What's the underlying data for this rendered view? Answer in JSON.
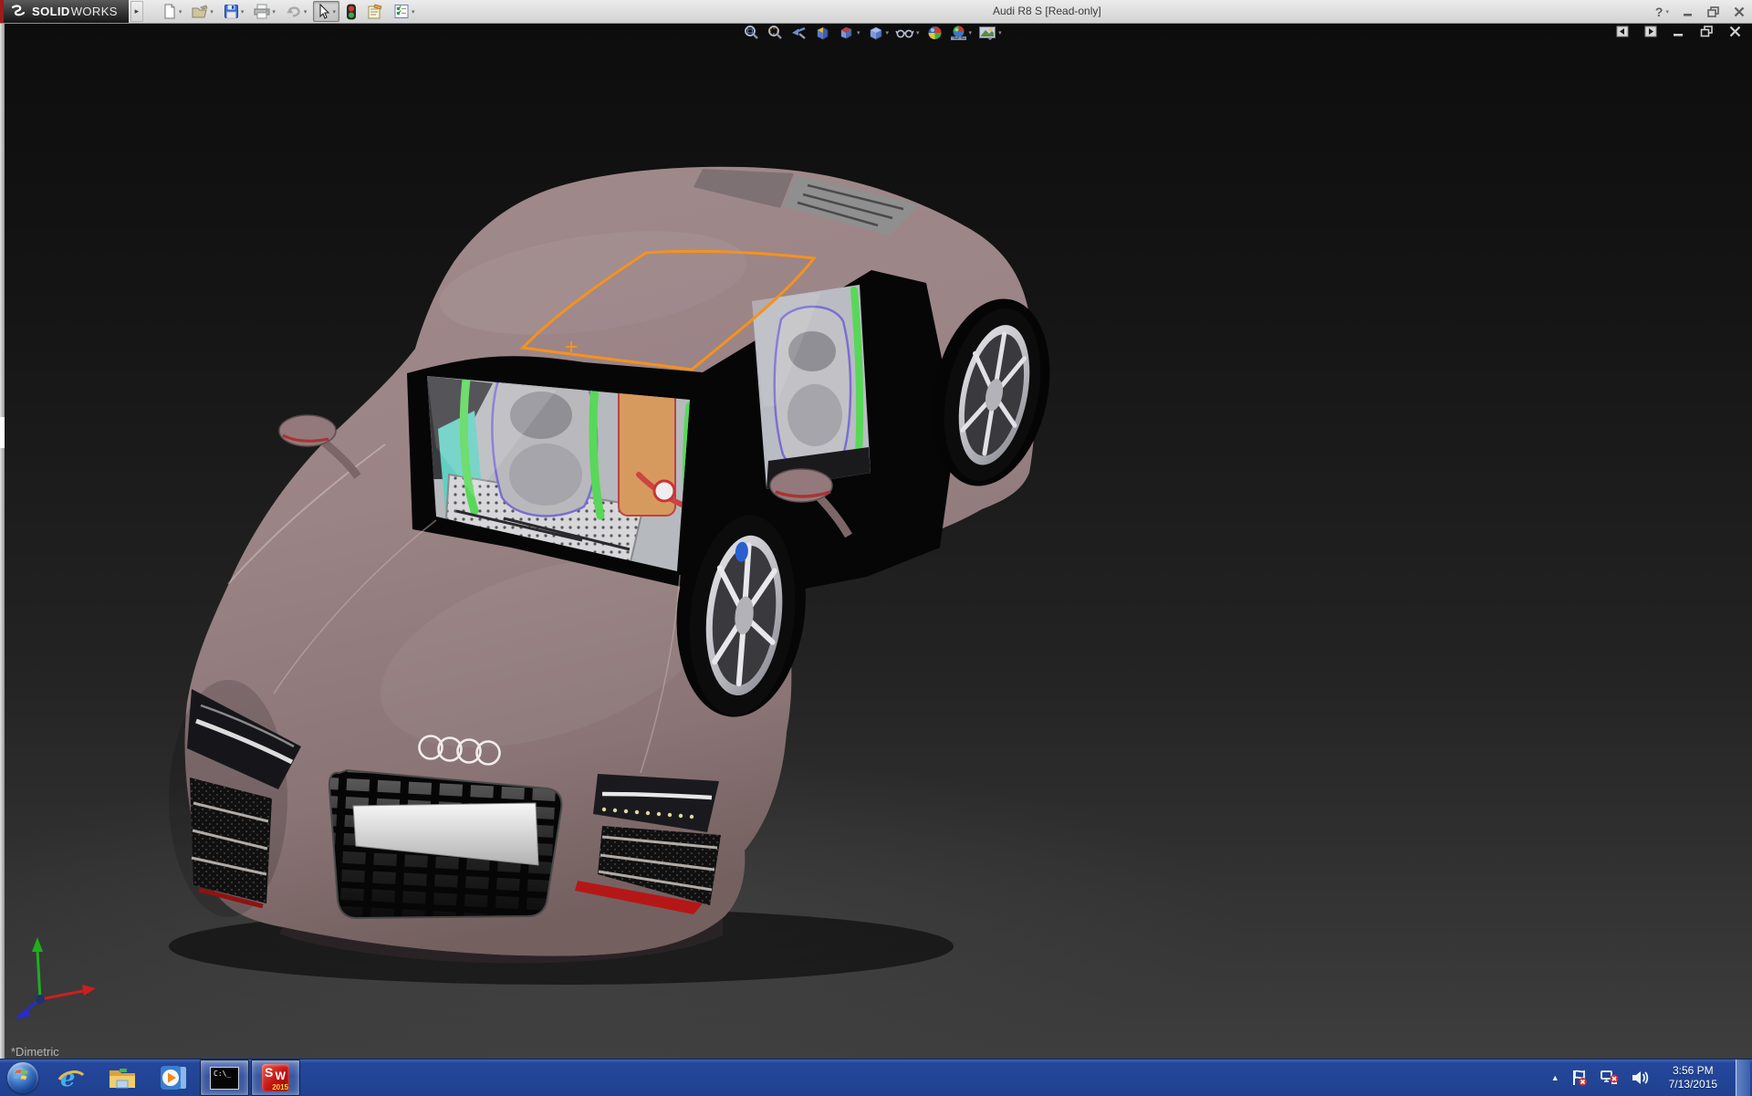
{
  "colors": {
    "car-body": "#9b8486",
    "car-body-dark": "#6f5c5e",
    "selection-orange": "#f5921e",
    "cage-green": "#58d858",
    "dash-teal": "#63cfc2",
    "interior-orange": "#d69a5e",
    "accent-red": "#b51717",
    "taskbar-blue": "#24479c",
    "titlebar-bg": "#dcdcdc",
    "viewport-top": "#0d0d0d",
    "viewport-bottom": "#3e3e3e"
  },
  "window": {
    "logo_solid": "SOLID",
    "logo_works": "WORKS",
    "title": "Audi R8 S [Read-only]",
    "menu_expand_glyph": "▸",
    "help_glyph": "?"
  },
  "main_toolbar": {
    "items": [
      "new",
      "open",
      "save",
      "print",
      "undo",
      "select",
      "rebuild",
      "file-properties",
      "options"
    ]
  },
  "headsup_toolbar": {
    "items": [
      "zoom-to-fit",
      "zoom-to-area",
      "previous-view",
      "section-view",
      "view-orientation",
      "display-style",
      "hide-show-items",
      "edit-appearance",
      "apply-scene",
      "view-settings"
    ]
  },
  "doc_controls": [
    "pane-left",
    "pane-right",
    "minimize",
    "restore",
    "close"
  ],
  "viewport": {
    "orientation_label": "*Dimetric"
  },
  "taskbar": {
    "items": [
      "start",
      "internet-explorer",
      "windows-explorer",
      "media-player",
      "command-prompt",
      "solidworks-2015"
    ],
    "active_items": [
      "command-prompt",
      "solidworks-2015"
    ],
    "cmd_label": "C:\\_",
    "sw_s": "S",
    "sw_w": "W",
    "sw_year": "2015",
    "tray_icons": [
      "show-hidden-icons",
      "action-center-flag",
      "network-disconnected",
      "volume"
    ],
    "clock": {
      "time": "3:56 PM",
      "date": "7/13/2015"
    }
  }
}
